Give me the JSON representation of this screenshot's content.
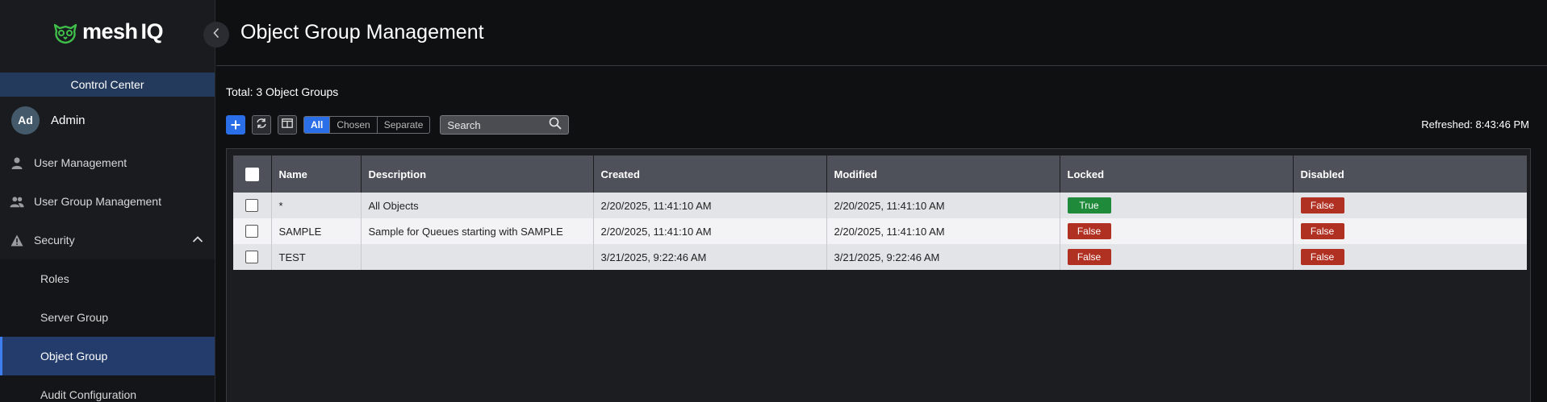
{
  "brand": {
    "logo_prefix": "mesh",
    "logo_suffix": "IQ"
  },
  "sidebar": {
    "section_title": "Control Center",
    "user": {
      "initials": "Ad",
      "name": "Admin"
    },
    "items": [
      {
        "label": "User Management",
        "icon": "user-icon"
      },
      {
        "label": "User Group Management",
        "icon": "users-icon"
      },
      {
        "label": "Security",
        "icon": "warning-icon",
        "expanded": true
      }
    ],
    "sub_items": [
      {
        "label": "Roles",
        "active": false
      },
      {
        "label": "Server Group",
        "active": false
      },
      {
        "label": "Object Group",
        "active": true
      },
      {
        "label": "Audit Configuration",
        "active": false
      }
    ]
  },
  "header": {
    "title": "Object Group Management"
  },
  "summary": {
    "total": "Total: 3 Object Groups"
  },
  "toolbar": {
    "filters": [
      "All",
      "Chosen",
      "Separate"
    ],
    "active_filter": "All",
    "search_placeholder": "Search",
    "refreshed": "Refreshed: 8:43:46 PM"
  },
  "table": {
    "columns": [
      "Name",
      "Description",
      "Created",
      "Modified",
      "Locked",
      "Disabled"
    ],
    "rows": [
      {
        "name": "*",
        "description": "All Objects",
        "created": "2/20/2025, 11:41:10 AM",
        "modified": "2/20/2025, 11:41:10 AM",
        "locked": "True",
        "disabled": "False"
      },
      {
        "name": "SAMPLE",
        "description": "Sample for Queues starting with SAMPLE",
        "created": "2/20/2025, 11:41:10 AM",
        "modified": "2/20/2025, 11:41:10 AM",
        "locked": "False",
        "disabled": "False"
      },
      {
        "name": "TEST",
        "description": "",
        "created": "3/21/2025, 9:22:46 AM",
        "modified": "3/21/2025, 9:22:46 AM",
        "locked": "False",
        "disabled": "False"
      }
    ]
  },
  "colors": {
    "accent": "#2a6ee8",
    "true_badge": "#1e8a3a",
    "false_badge": "#b03022",
    "active_nav": "#233c6c"
  }
}
